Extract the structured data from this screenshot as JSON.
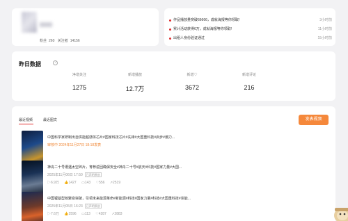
{
  "profile": {
    "fans_label": "粉丝",
    "fans_value": "260",
    "follow_label": "关注者",
    "follow_value": "14156"
  },
  "notices": [
    {
      "text": "作品播放量突破66666，成就海报等你领取!",
      "time": "3小时前"
    },
    {
      "text": "累计活动获得6万，成就海报等你领取!",
      "time": "11小时前"
    },
    {
      "text": "出租人身份验证通过",
      "time": "15小时前"
    }
  ],
  "stats": {
    "title": "昨日数据",
    "items": [
      {
        "label": "净增关注",
        "value": "1275"
      },
      {
        "label": "新增播放",
        "value": "12.7万"
      },
      {
        "label": "新增♡",
        "value": "3672"
      },
      {
        "label": "新增评论",
        "value": "216"
      }
    ]
  },
  "works": {
    "tabs": [
      "最近视频",
      "最近图文"
    ],
    "publish_label": "发表视频",
    "items": [
      {
        "title": "中国科学家研制出自供能超感体芯片#国家科技芯片#先锋#大国重科技#启步#潮力...",
        "review": "审核中 2024年11月27日 18:18发表"
      },
      {
        "title": "神舟二十号遭遇太空碎片，育荐返回确保安全#神舟二十号#航天#科技#国家力量#大国...",
        "meta": "2025年11月06日 17:50",
        "tag": "已声明原创",
        "stats": [
          "6.9万",
          "1427",
          "143",
          "556",
          "2519"
        ]
      },
      {
        "title": "中国锂基型核聚变突破，引领未来能源革命#新能源#科技#国家力量#科技#大国重科技#崇能...",
        "meta": "2025年11月05日 16:23",
        "tag": "已声明原创",
        "stats": [
          "7.6万",
          "2596",
          "113",
          "4287",
          "2883"
        ]
      }
    ]
  },
  "icons": {
    "info": "info-icon",
    "play": "play-icon",
    "like": "thumbs-up-icon",
    "comment": "comment-icon",
    "heart": "heart-icon",
    "share": "share-icon"
  },
  "colors": {
    "accent": "#f5883b",
    "alert": "#e02e2e"
  }
}
